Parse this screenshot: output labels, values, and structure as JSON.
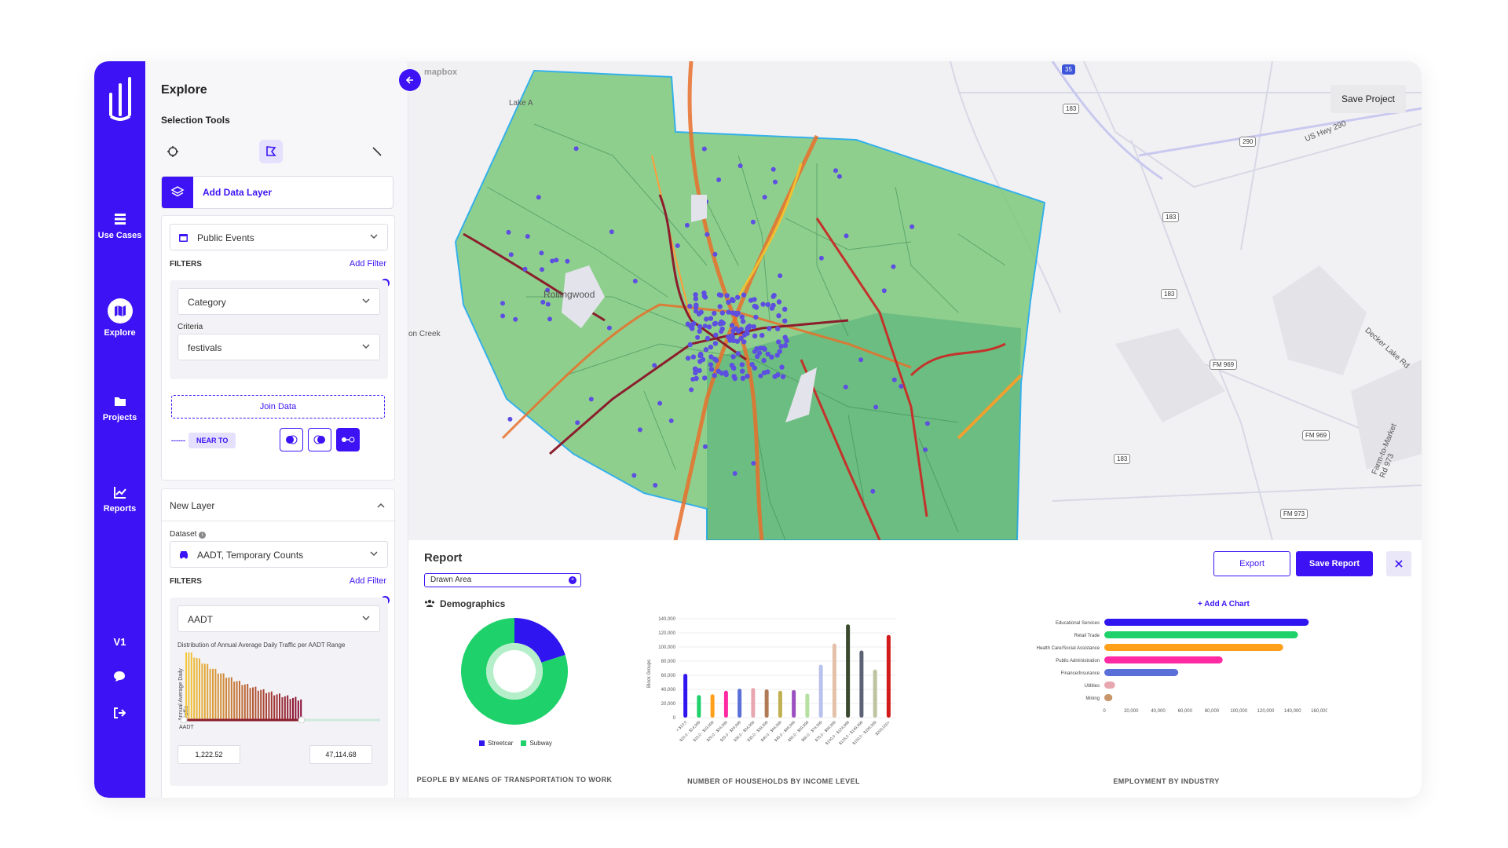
{
  "rail": {
    "items": [
      {
        "label": "Use Cases",
        "icon": "grid-icon"
      },
      {
        "label": "Explore",
        "icon": "map-icon"
      },
      {
        "label": "Projects",
        "icon": "folder-icon"
      },
      {
        "label": "Reports",
        "icon": "chart-icon"
      }
    ],
    "version": "V1"
  },
  "panel": {
    "title": "Explore",
    "selection_tools_label": "Selection Tools",
    "add_data_layer": "Add Data Layer",
    "layer1": {
      "dataset": "Public Events",
      "filters_label": "FILTERS",
      "add_filter": "Add Filter",
      "filter_field": "Category",
      "criteria_label": "Criteria",
      "criteria_value": "festivals",
      "join_data": "Join Data",
      "near_to": "NEAR TO"
    },
    "layer2": {
      "title": "New Layer",
      "dataset_label": "Dataset",
      "dataset": "AADT, Temporary Counts",
      "filters_label": "FILTERS",
      "add_filter": "Add Filter",
      "filter_field": "AADT",
      "hist_title": "Distribution of Annual Average Daily Traffic per AADT Range",
      "hist_ylabel": "Annual Average Daily Traffic",
      "hist_xlabel": "AADT",
      "min_value": "1,222.52",
      "max_value": "47,114.68"
    }
  },
  "map": {
    "save_project": "Save Project",
    "attribution": "mapbox",
    "labels": [
      "Rollingwood",
      "on Creek",
      "Lake A",
      "US Hwy 290",
      "Decker Lake Rd",
      "Farm-to-Market Rd 973"
    ],
    "shields": [
      "183",
      "290",
      "183",
      "183",
      "183",
      "FM 969",
      "FM 969",
      "FM 973",
      "35"
    ]
  },
  "report": {
    "title": "Report",
    "area_chip": "Drawn Area",
    "export": "Export",
    "save_report": "Save Report",
    "section": "Demographics",
    "add_chart": "+ Add A Chart",
    "captions": [
      "PEOPLE BY MEANS OF TRANSPORTATION TO WORK",
      "NUMBER OF HOUSEHOLDS BY INCOME LEVEL",
      "EMPLOYMENT BY INDUSTRY"
    ]
  },
  "colors": {
    "accent": "#3d13f5",
    "map_fill": "#6cc070",
    "donut_green": "#1fd16b",
    "donut_blue": "#2f16f0"
  },
  "chart_data": [
    {
      "type": "pie",
      "title": "PEOPLE BY MEANS OF TRANSPORTATION TO WORK",
      "categories": [
        "Streetcar",
        "Subway"
      ],
      "values": [
        20,
        80
      ],
      "legend": "bottom"
    },
    {
      "type": "bar",
      "title": "NUMBER OF HOUSEHOLDS BY INCOME LEVEL",
      "ylabel": "Block Groups",
      "ylim": [
        0,
        140000
      ],
      "yticks": [
        "0",
        "20,000",
        "40,000",
        "60,000",
        "80,000",
        "100,000",
        "120,000",
        "140,000"
      ],
      "categories": [
        "< $10,0",
        "$10,0 - $14,999",
        "$15,0 - $19,999",
        "$20,0 - $24,999",
        "$25,0 - $29,999",
        "$30,0 - $34,999",
        "$35,0 - $39,999",
        "$40,0 - $44,999",
        "$45,0 - $49,999",
        "$50,0 - $59,999",
        "$60,0 - $74,999",
        "$75,0 - $99,999",
        "$100,0 - $124,999",
        "$125,0 - $149,999",
        "$150,0 - $199,999",
        "$200,000+"
      ],
      "values": [
        62000,
        32000,
        33000,
        38000,
        41000,
        42000,
        40000,
        38000,
        39000,
        34000,
        75000,
        105000,
        132000,
        95000,
        68000,
        117000
      ],
      "colors": [
        "#2f16f0",
        "#1fd16b",
        "#ff9f1a",
        "#ff2aa3",
        "#5b6fd8",
        "#e8a6b0",
        "#b07a55",
        "#c0b050",
        "#9b4fc0",
        "#b6e0a0",
        "#b9c2ec",
        "#e4c1a8",
        "#3a4a2e",
        "#5b6274",
        "#bfc4a0",
        "#d21a1a"
      ]
    },
    {
      "type": "bar",
      "orientation": "horizontal",
      "title": "EMPLOYMENT BY INDUSTRY",
      "categories": [
        "Educational Services",
        "Retail Trade",
        "Health Care/Social Assistance",
        "Public Administration",
        "Finance/Insurance",
        "Utilities",
        "Mining"
      ],
      "values": [
        152000,
        144000,
        133000,
        88000,
        55000,
        8000,
        6000
      ],
      "colors": [
        "#2f16f0",
        "#1fd16b",
        "#ff9f1a",
        "#ff2aa3",
        "#5b6fd8",
        "#e8a6b0",
        "#c9956a"
      ],
      "xlim": [
        0,
        160000
      ],
      "xticks": [
        "0",
        "20,000",
        "40,000",
        "60,000",
        "80,000",
        "100,000",
        "120,000",
        "140,000",
        "160,000"
      ]
    }
  ]
}
